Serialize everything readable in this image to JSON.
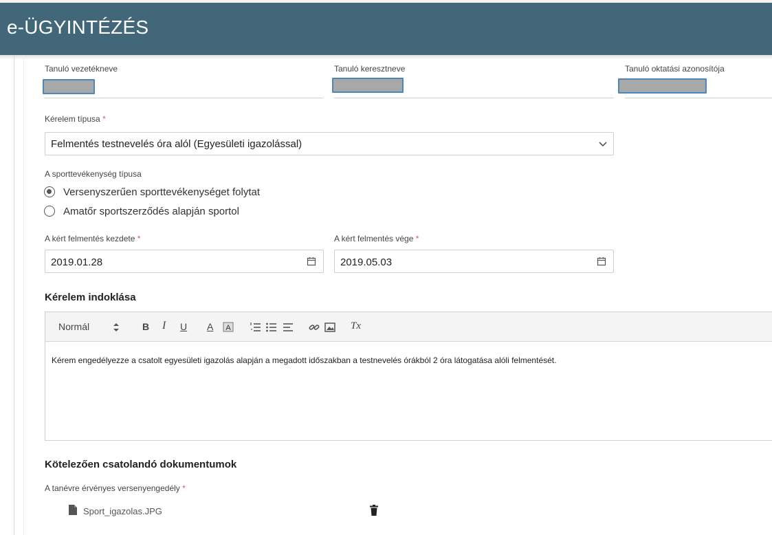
{
  "app": {
    "title": "e-ÜGYINTÉZÉS"
  },
  "student": {
    "last_name_label": "Tanuló vezetékneve",
    "first_name_label": "Tanuló keresztneve",
    "id_label": "Tanuló oktatási azonosítója"
  },
  "request_type": {
    "label": "Kérelem típusa",
    "required_mark": "*",
    "selected": "Felmentés testnevelés óra alól (Egyesületi igazolással)"
  },
  "sport_type": {
    "label": "A sporttevékenység típusa",
    "options": [
      {
        "label": "Versenyszerűen sporttevékenységet folytat",
        "selected": true
      },
      {
        "label": "Amatőr sportszerződés alapján sportol",
        "selected": false
      }
    ]
  },
  "exemption": {
    "start_label": "A kért felmentés kezdete",
    "start_value": "2019.01.28",
    "end_label": "A kért felmentés vége",
    "end_value": "2019.05.03",
    "required_mark": "*"
  },
  "justification": {
    "title": "Kérelem indoklása",
    "toolbar": {
      "format": "Normál",
      "bold": "B",
      "italic": "I",
      "underline": "U",
      "font_color": "A",
      "clear_format": "Tx"
    },
    "text": "Kérem engedélyezze a csatolt egyesületi igazolás alapján a megadott időszakban a testnevelés órákból 2 óra látogatása alóli felmentését."
  },
  "documents": {
    "title": "Kötelezően csatolandó dokumentumok",
    "license_label": "A tanévre érvényes versenyengedély",
    "required_mark": "*",
    "file_name": "Sport_igazolas.JPG"
  }
}
